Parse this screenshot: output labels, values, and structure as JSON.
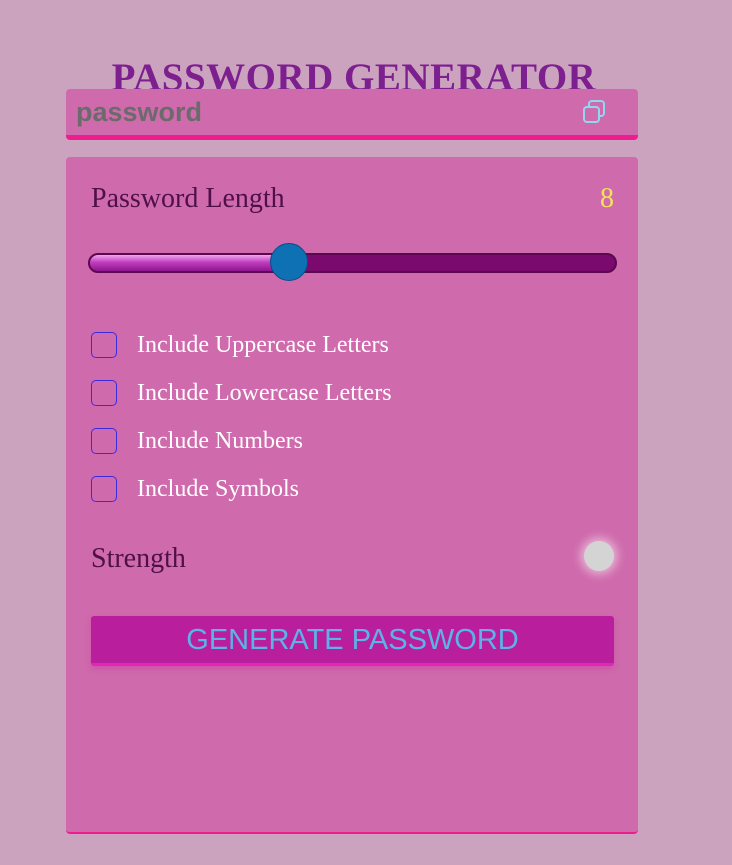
{
  "title": "PASSWORD GENERATOR",
  "display": {
    "placeholder": "password",
    "value": "",
    "copy_icon": "copy-icon"
  },
  "length": {
    "label": "Password Length",
    "value": "8",
    "min": 1,
    "max": 20,
    "fraction": 0.38
  },
  "options": [
    {
      "label": "Include Uppercase Letters",
      "checked": false
    },
    {
      "label": "Include Lowercase Letters",
      "checked": false
    },
    {
      "label": "Include Numbers",
      "checked": false
    },
    {
      "label": "Include Symbols",
      "checked": false
    }
  ],
  "strength": {
    "label": "Strength",
    "indicator_color": "#d4d4d4"
  },
  "generate_label": "GENERATE PASSWORD",
  "colors": {
    "background": "#cca3bf",
    "panel": "#cf6aac",
    "accent": "#ee1d8f",
    "title": "#7d1f8f",
    "button": "#b91e9d",
    "button_text": "#5bb3ea",
    "length_value": "#f5e15a",
    "thumb": "#0e71b3"
  }
}
